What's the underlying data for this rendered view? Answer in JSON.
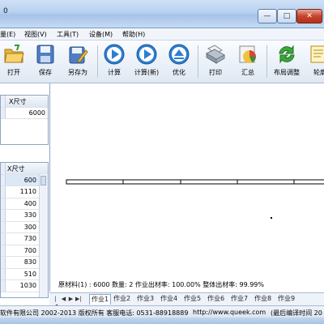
{
  "window": {
    "title": "0",
    "min": "—",
    "max": "□",
    "close": "✕"
  },
  "menu": [
    "量(E)",
    "视图(V)",
    "工具(T)",
    "设备(M)",
    "帮助(H)"
  ],
  "toolbar": [
    {
      "label": "打开",
      "icon": "open-folder-icon"
    },
    {
      "label": "保存",
      "icon": "save-icon"
    },
    {
      "label": "另存为",
      "icon": "save-as-icon"
    },
    {
      "label": "计算",
      "icon": "play-icon"
    },
    {
      "label": "计算(新)",
      "icon": "play-icon"
    },
    {
      "label": "优化",
      "icon": "eject-icon"
    },
    {
      "label": "打印",
      "icon": "printer-icon"
    },
    {
      "label": "汇总",
      "icon": "summary-icon"
    },
    {
      "label": "布局调整",
      "icon": "refresh-icon"
    },
    {
      "label": "轮廓",
      "icon": "outline-icon"
    }
  ],
  "material_grid": {
    "header": "X尺寸",
    "value": "6000"
  },
  "parts_grid": {
    "header": "X尺寸",
    "rows": [
      "600",
      "1110",
      "400",
      "330",
      "300",
      "730",
      "700",
      "830",
      "510",
      "1030"
    ]
  },
  "info": {
    "text": "原材料(1) : 6000  数量: 2   作业出材率: 100.00%   整体出材率: 99.99%"
  },
  "tabs": [
    "作业1",
    "作业2",
    "作业3",
    "作业4",
    "作业5",
    "作业6",
    "作业7",
    "作业8",
    "作业9"
  ],
  "status": {
    "copyright": "软件有限公司  2002-2013 版权所有  客服电话: 0531-88918889",
    "website": "http://www.queek.com",
    "compile": "(最后编译时间 20"
  },
  "colors": {
    "accent": "#3d7cc9",
    "grid_selected": "#dbe8f8",
    "nesting_bar": "#000000"
  }
}
